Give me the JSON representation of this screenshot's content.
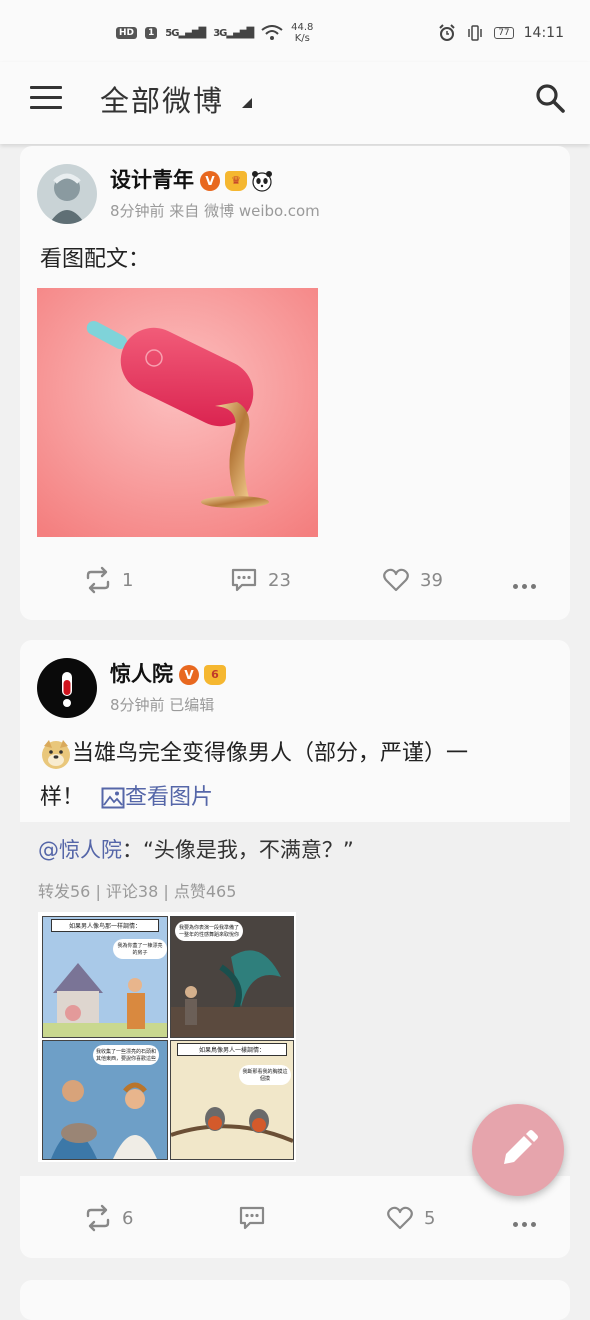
{
  "status_bar": {
    "hd": "HD",
    "sim": "1",
    "signal1": "5G",
    "signal2": "3G",
    "speed_value": "44.8",
    "speed_unit": "K/s",
    "battery": "77",
    "time": "14:11"
  },
  "app_bar": {
    "title": "全部微博",
    "menu_icon": "menu-icon",
    "search_icon": "search-icon"
  },
  "posts": [
    {
      "username": "设计青年",
      "verified_badge": "V",
      "meta": "8分钟前  来自 微博 weibo.com",
      "text": "看图配文：",
      "image_desc": "pink ice cream bar melting into gold",
      "actions": {
        "reposts": "1",
        "comments": "23",
        "likes": "39"
      }
    },
    {
      "username": "惊人院",
      "verified_badge": "V",
      "crown_level": "6",
      "meta": "8分钟前  已编辑",
      "text_line1": "当雄鸟完全变得像男人（部分，严谨）一",
      "text_line2": "样！",
      "link_label": "查看图片",
      "retweet": {
        "author": "@惊人院",
        "quote": "：“头像是我，不满意？”",
        "stats": "转发56 | 评论38 | 点赞465",
        "comic_captions": [
          "如果男人像鸟那一样調情：",
          "我為你蓋了一棟漂亮的房子",
          "我要為你表演一段我準備了一整年的性感舞蹈來取悅你",
          "我收集了一些漂亮的石頭和其他東西，要說你喜歡這些",
          "如果鳥像男人一樣調情：",
          "我斷那看我的胸摸這個摸"
        ]
      },
      "actions": {
        "reposts": "6",
        "comments": "",
        "likes": "5"
      }
    }
  ],
  "fab": {
    "icon": "pencil-icon"
  },
  "colors": {
    "accent_link": "#5566a8",
    "vip_orange": "#e8681f",
    "fab": "#e6a4ac"
  }
}
